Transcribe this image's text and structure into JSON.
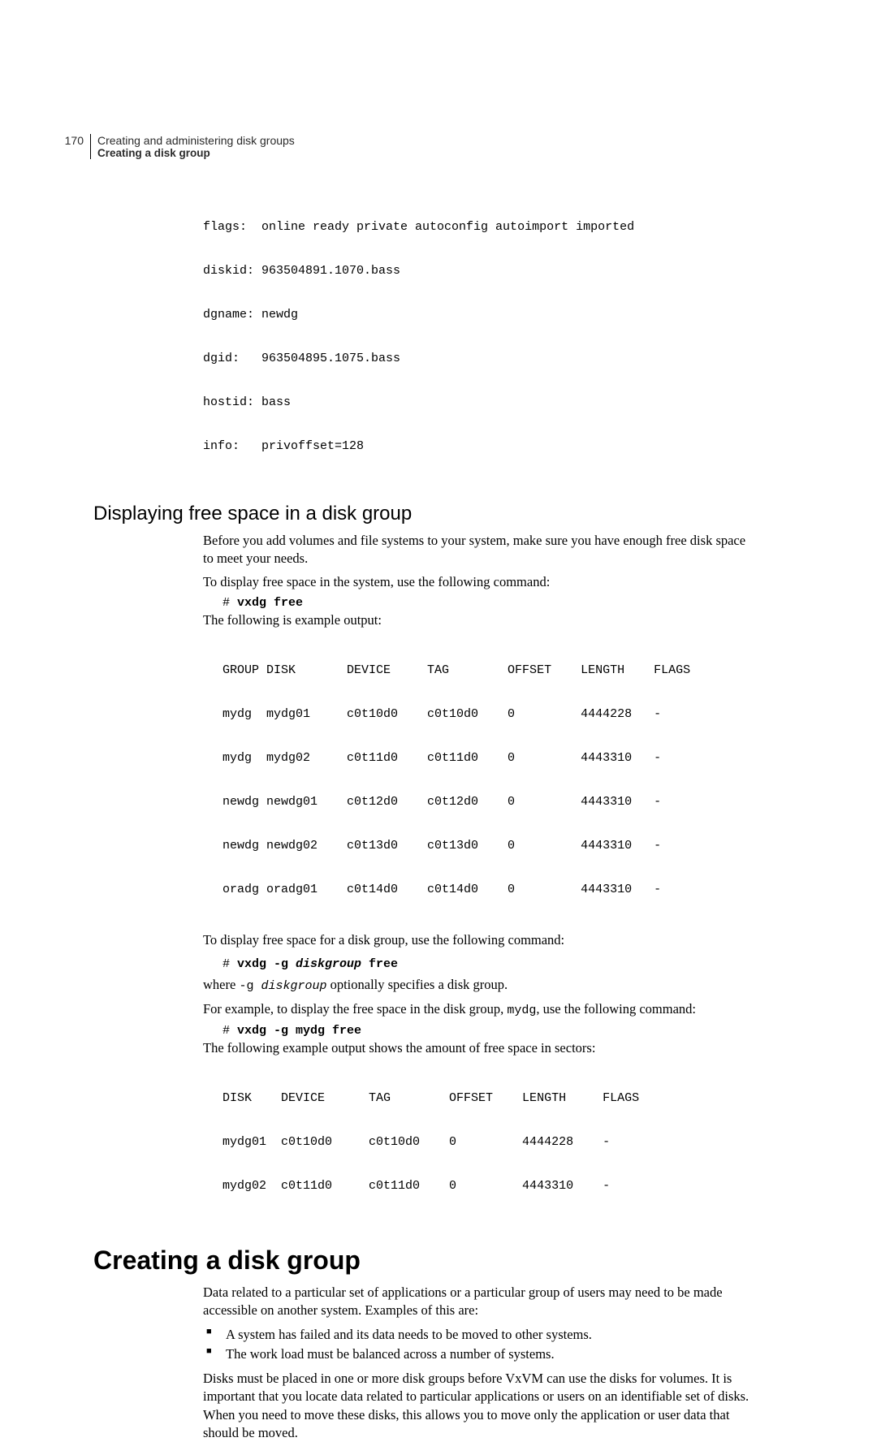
{
  "header": {
    "page_number": "170",
    "line1": "Creating and administering disk groups",
    "line2": "Creating a disk group"
  },
  "disk_record": {
    "lines": [
      "flags:  online ready private autoconfig autoimport imported",
      "diskid: 963504891.1070.bass",
      "dgname: newdg",
      "dgid:   963504895.1075.bass",
      "hostid: bass",
      "info:   privoffset=128"
    ]
  },
  "section1": {
    "title": "Displaying free space in a disk group",
    "para1": "Before you add volumes and file systems to your system, make sure you have enough free disk space to meet your needs.",
    "para2": "To display free space in the system, use the following command:",
    "cmd1_prompt": "# ",
    "cmd1_bold": "vxdg free",
    "para3": "The following is example output:",
    "table1": [
      "GROUP DISK       DEVICE     TAG        OFFSET    LENGTH    FLAGS",
      "mydg  mydg01     c0t10d0    c0t10d0    0         4444228   -",
      "mydg  mydg02     c0t11d0    c0t11d0    0         4443310   -",
      "newdg newdg01    c0t12d0    c0t12d0    0         4443310   -",
      "newdg newdg02    c0t13d0    c0t13d0    0         4443310   -",
      "oradg oradg01    c0t14d0    c0t14d0    0         4443310   -"
    ],
    "para4": "To display free space for a disk group, use the following command:",
    "cmd2_prompt": "# ",
    "cmd2_b1": "vxdg -g ",
    "cmd2_bi": "diskgroup",
    "cmd2_b2": " free",
    "para5_a": "where ",
    "para5_mono": "-g ",
    "para5_mono_i": "diskgroup",
    "para5_b": " optionally specifies a disk group.",
    "para6_a": "For example, to display the free space in the disk group, ",
    "para6_mono": "mydg",
    "para6_b": ", use the following command:",
    "cmd3_prompt": "# ",
    "cmd3_bold": "vxdg -g mydg free",
    "para7": "The following example output shows the amount of free space in sectors:",
    "table2": [
      "DISK    DEVICE      TAG        OFFSET    LENGTH     FLAGS",
      "mydg01  c0t10d0     c0t10d0    0         4444228    -",
      "mydg02  c0t11d0     c0t11d0    0         4443310    -"
    ]
  },
  "section2": {
    "title": "Creating a disk group",
    "para1": "Data related to a particular set of applications or a particular group of users may need to be made accessible on another system. Examples of this are:",
    "bullets": [
      "A system has failed and its data needs to be moved to other systems.",
      "The work load must be balanced across a number of systems."
    ],
    "para2": "Disks must be placed in one or more disk groups before VxVM can use the disks for volumes. It is important that you locate data related to particular applications or users on an identifiable set of disks. When you need to move these disks, this allows you to move only the application or user data that should be moved."
  }
}
